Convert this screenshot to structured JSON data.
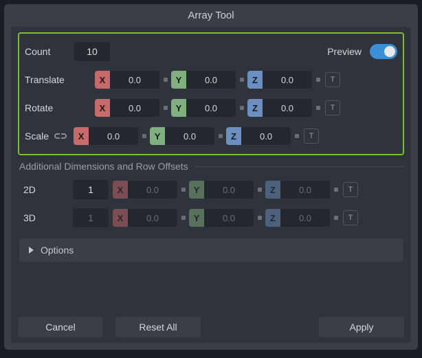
{
  "title": "Array Tool",
  "count": {
    "label": "Count",
    "value": "10"
  },
  "preview": {
    "label": "Preview",
    "on": true
  },
  "transforms": {
    "translate": {
      "label": "Translate",
      "x": "0.0",
      "y": "0.0",
      "z": "0.0"
    },
    "rotate": {
      "label": "Rotate",
      "x": "0.0",
      "y": "0.0",
      "z": "0.0"
    },
    "scale": {
      "label": "Scale",
      "x": "0.0",
      "y": "0.0",
      "z": "0.0"
    }
  },
  "axis": {
    "x": "X",
    "y": "Y",
    "z": "Z",
    "reset": "T"
  },
  "additional": {
    "header": "Additional Dimensions and Row Offsets",
    "d2": {
      "label": "2D",
      "count": "1",
      "x": "0.0",
      "y": "0.0",
      "z": "0.0"
    },
    "d3": {
      "label": "3D",
      "count": "1",
      "x": "0.0",
      "y": "0.0",
      "z": "0.0"
    }
  },
  "options": {
    "label": "Options"
  },
  "buttons": {
    "cancel": "Cancel",
    "reset": "Reset All",
    "apply": "Apply"
  }
}
